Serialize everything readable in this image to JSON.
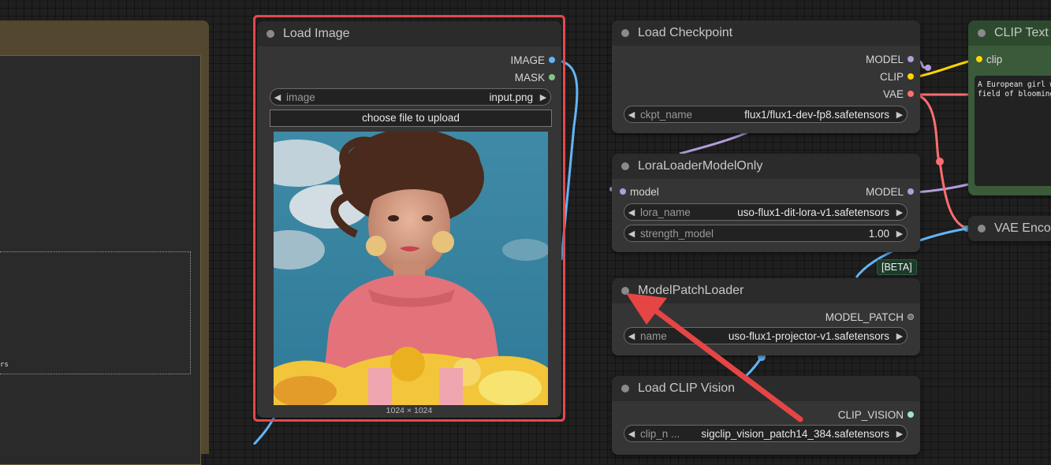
{
  "colors": {
    "selection": "#e5484d",
    "image_port": "#64b5f6",
    "mask_port": "#81c784",
    "model_port": "#b39ddb",
    "clip_port": "#ffd500",
    "vae_port": "#ff6e6e",
    "clip_vision_port": "#a1e3d6",
    "annotation_arrow": "#e64545"
  },
  "load_image": {
    "title": "Load Image",
    "outputs": [
      "IMAGE",
      "MASK"
    ],
    "image_widget": {
      "label": "image",
      "value": "input.png"
    },
    "upload_label": "choose file to upload",
    "preview_size": "1024 × 1024"
  },
  "load_checkpoint": {
    "title": "Load Checkpoint",
    "outputs": [
      "MODEL",
      "CLIP",
      "VAE"
    ],
    "ckpt_widget": {
      "label": "ckpt_name",
      "value": "flux1/flux1-dev-fp8.safetensors"
    }
  },
  "lora_loader": {
    "title": "LoraLoaderModelOnly",
    "input": "model",
    "output": "MODEL",
    "lora_widget": {
      "label": "lora_name",
      "value": "uso-flux1-dit-lora-v1.safetensors"
    },
    "strength_widget": {
      "label": "strength_model",
      "value": "1.00"
    }
  },
  "model_patch_loader": {
    "badge": "[BETA]",
    "title": "ModelPatchLoader",
    "output": "MODEL_PATCH",
    "name_widget": {
      "label": "name",
      "value": "uso-flux1-projector-v1.safetensors"
    }
  },
  "load_clip_vision": {
    "title": "Load CLIP Vision",
    "output": "CLIP_VISION",
    "clip_widget": {
      "label": "clip_n ...",
      "value": "sigclip_vision_patch14_384.safetensors"
    }
  },
  "clip_text": {
    "title": "CLIP Text",
    "input": "clip",
    "text": "A European girl w\nfield of blooming"
  },
  "vae_encode": {
    "title": "VAE Enco"
  },
  "left_panel": {
    "text": "rs"
  },
  "icons": {
    "widget_decrement": "triangle-left-icon",
    "widget_increment": "triangle-right-icon",
    "status_dot": "circle-icon"
  }
}
